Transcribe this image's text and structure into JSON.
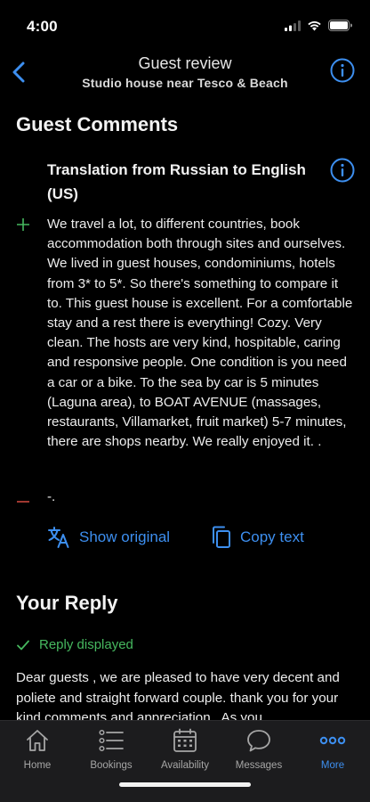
{
  "status": {
    "time": "4:00"
  },
  "header": {
    "title": "Guest review",
    "subtitle": "Studio house near Tesco & Beach",
    "accent": "#3d8ff0"
  },
  "comments": {
    "section_title": "Guest Comments",
    "translation_title": "Translation from Russian to English (US)",
    "positive_text": " We travel a lot, to different countries, book accommodation both through sites and ourselves. We lived in guest houses, condominiums, hotels from 3* to 5*. So there's something to compare it to. This guest house is excellent. For a comfortable stay and a rest there is everything! Cozy. Very clean. The hosts are very kind, hospitable, caring and responsive people. One condition is you need a car or a bike. To the sea by car is 5 minutes (Laguna area), to BOAT AVENUE (massages, restaurants, Villamarket, fruit market) 5-7 minutes, there are shops nearby. We really enjoyed it.  .",
    "negative_text": "-.",
    "positive_color": "#46b85f",
    "negative_color": "#c8463c",
    "show_original_label": "Show original",
    "copy_text_label": "Copy text"
  },
  "reply": {
    "section_title": "Your Reply",
    "status": "Reply displayed",
    "text": "Dear guests , we are pleased to have very decent and poliete and straight forward couple. thank you for your kind comments and appreciation . As you"
  },
  "tabs": [
    {
      "label": "Home",
      "icon": "home-icon",
      "active": false
    },
    {
      "label": "Bookings",
      "icon": "list-icon",
      "active": false
    },
    {
      "label": "Availability",
      "icon": "calendar-icon",
      "active": false
    },
    {
      "label": "Messages",
      "icon": "chat-bubble-icon",
      "active": false
    },
    {
      "label": "More",
      "icon": "more-dots-icon",
      "active": true
    }
  ]
}
